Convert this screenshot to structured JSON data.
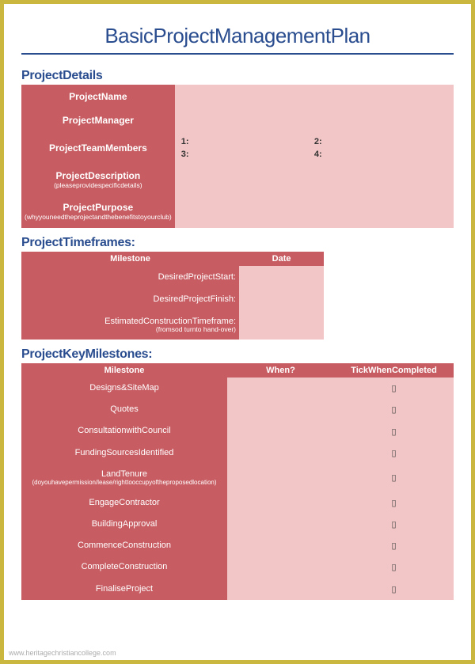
{
  "title": "BasicProjectManagementPlan",
  "sections": {
    "details": {
      "heading": "ProjectDetails",
      "rows": [
        {
          "label": "ProjectName",
          "sub": ""
        },
        {
          "label": "ProjectManager",
          "sub": ""
        },
        {
          "label": "ProjectTeamMembers",
          "sub": "",
          "members": {
            "m1": "1:",
            "m2": "2:",
            "m3": "3:",
            "m4": "4:"
          }
        },
        {
          "label": "ProjectDescription",
          "sub": "(pleaseprovidespecificdetails)"
        },
        {
          "label": "ProjectPurpose",
          "sub": "(whyyouneedtheprojectandthebenefitstoyourclub)"
        }
      ]
    },
    "timeframes": {
      "heading": "ProjectTimeframes:",
      "col_milestone": "Milestone",
      "col_date": "Date",
      "rows": [
        {
          "label": "DesiredProjectStart:",
          "sub": ""
        },
        {
          "label": "DesiredProjectFinish:",
          "sub": ""
        },
        {
          "label": "EstimatedConstructionTimeframe:",
          "sub": "(fromsod turnto hand-over)"
        }
      ]
    },
    "milestones": {
      "heading": "ProjectKeyMilestones:",
      "col_milestone": "Milestone",
      "col_when": "When?",
      "col_tick": "TickWhenCompleted",
      "tick_char": "▯",
      "rows": [
        {
          "label": "Designs&SiteMap",
          "sub": ""
        },
        {
          "label": "Quotes",
          "sub": ""
        },
        {
          "label": "ConsultationwithCouncil",
          "sub": ""
        },
        {
          "label": "FundingSourcesIdentified",
          "sub": ""
        },
        {
          "label": "LandTenure",
          "sub": "(doyouhavepermission/lease/righttooccupyoftheproposedlocation)"
        },
        {
          "label": "EngageContractor",
          "sub": ""
        },
        {
          "label": "BuildingApproval",
          "sub": ""
        },
        {
          "label": "CommenceConstruction",
          "sub": ""
        },
        {
          "label": "CompleteConstruction",
          "sub": ""
        },
        {
          "label": "FinaliseProject",
          "sub": ""
        }
      ]
    }
  },
  "watermark": "www.heritagechristiancollege.com"
}
